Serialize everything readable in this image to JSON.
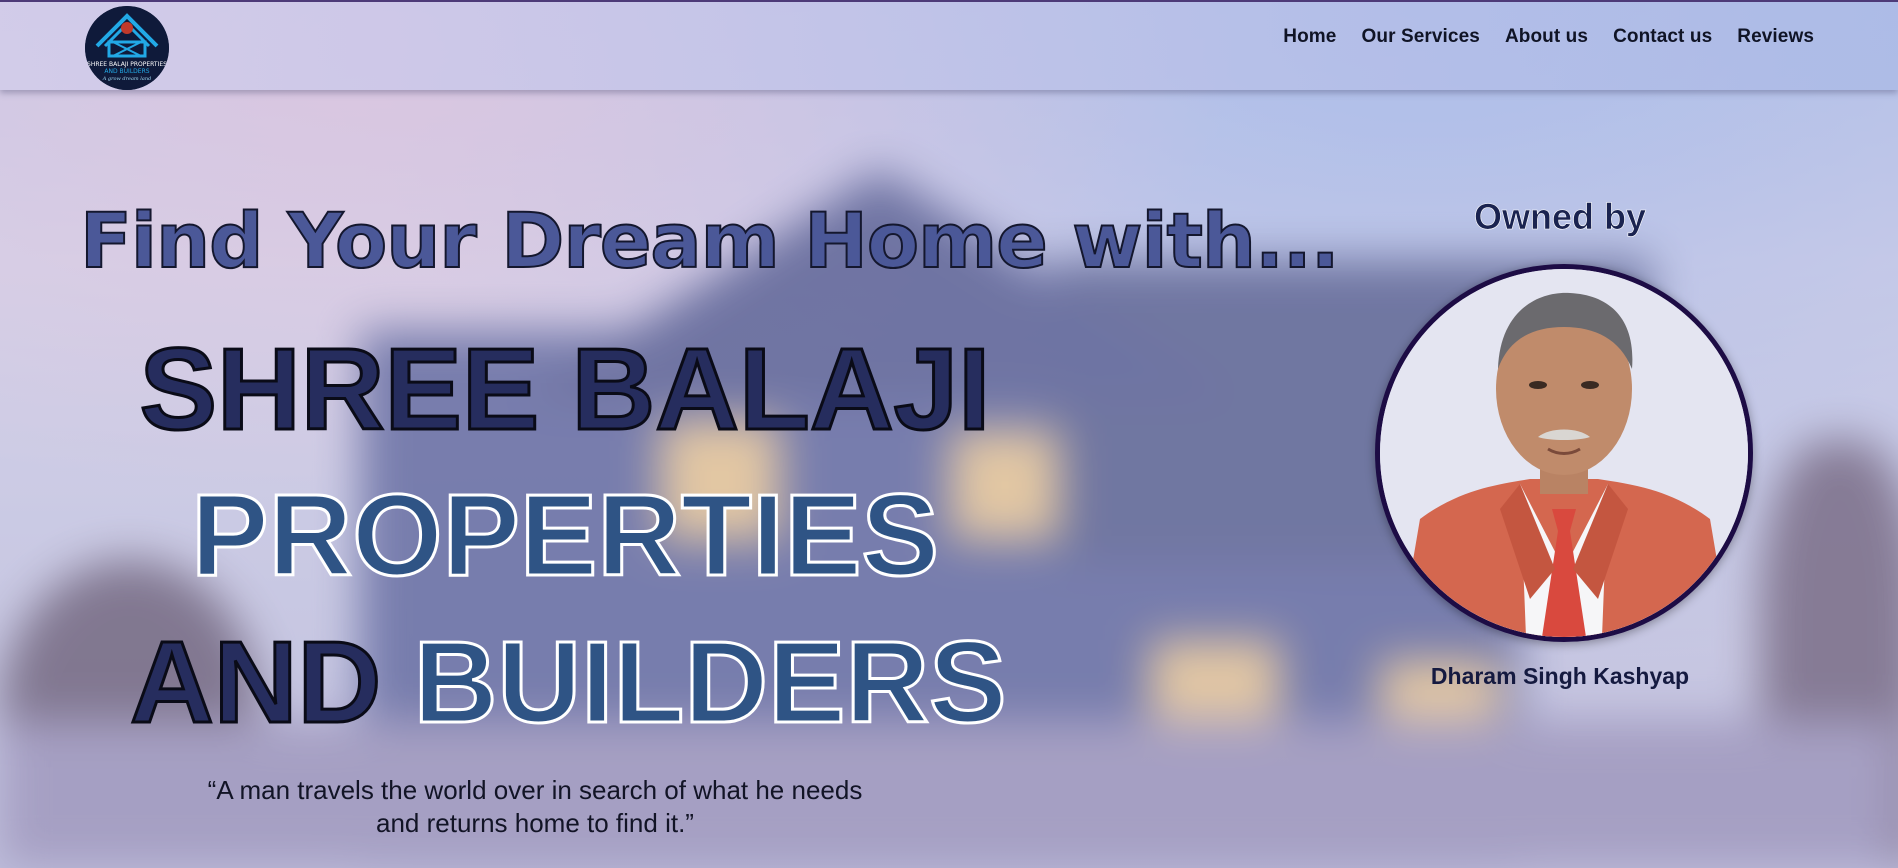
{
  "header": {
    "logo_alt": "Shree Balaji Properties and Builders logo",
    "logo_text_line1": "SHREE BALAJI PROPERTIES",
    "logo_text_line2": "AND BUILDERS",
    "logo_tagline": "A grow dream land",
    "nav": [
      {
        "label": "Home"
      },
      {
        "label": "Our Services"
      },
      {
        "label": "About us"
      },
      {
        "label": "Contact us"
      },
      {
        "label": "Reviews"
      }
    ]
  },
  "hero": {
    "tagline": "Find Your Dream Home with...",
    "title_line1": "SHREE BALAJI",
    "title_line2": "PROPERTIES",
    "title_line3_dark": "AND",
    "title_line3_light": "BUILDERS",
    "quote_line1": "“A man travels the world over in search of what he needs",
    "quote_line2": "and returns home to find it.”"
  },
  "owner": {
    "heading": "Owned by",
    "name": "Dharam Singh Kashyap"
  },
  "colors": {
    "title_dark": "#262d5e",
    "title_light": "#2f5485",
    "tagline": "#4b5898",
    "photo_border": "#1d0c45"
  }
}
